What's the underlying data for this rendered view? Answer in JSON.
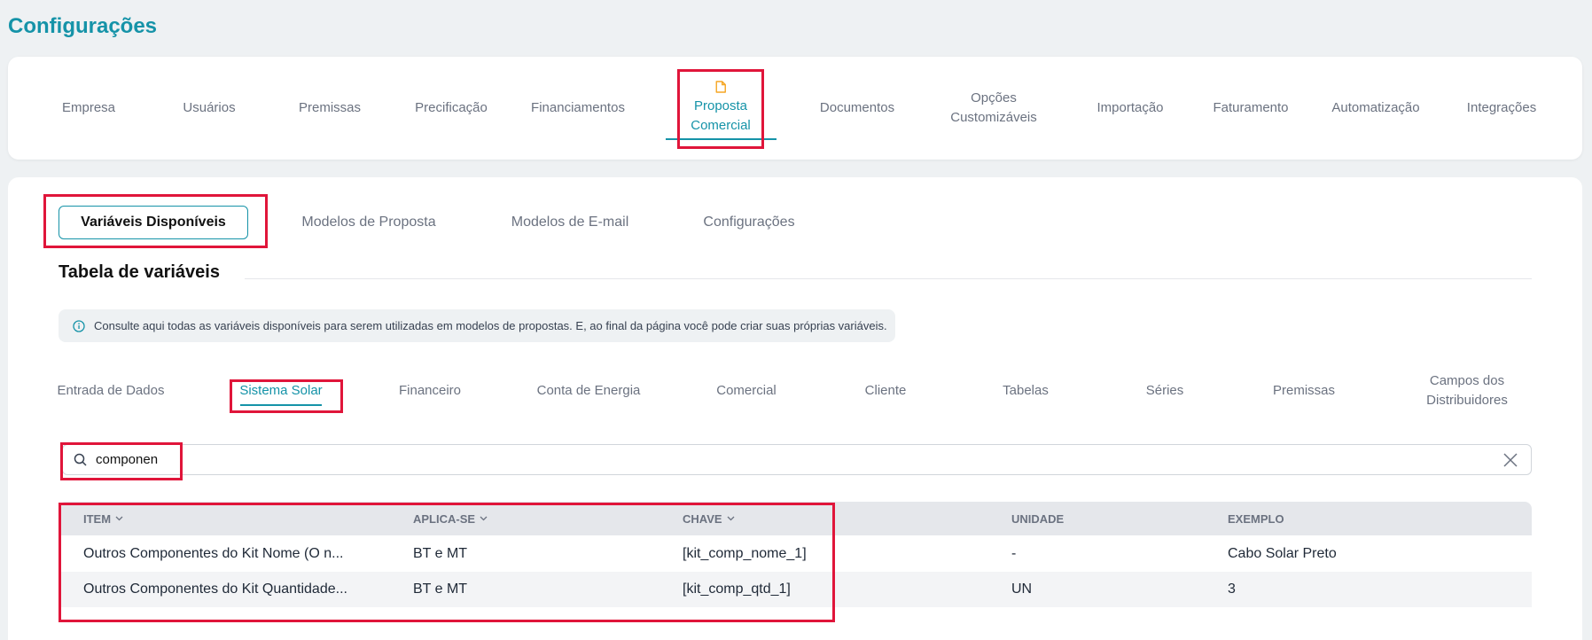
{
  "page_title": "Configurações",
  "nav": {
    "items": [
      {
        "label": "Empresa",
        "lines": [
          "Empresa"
        ]
      },
      {
        "label": "Usuários",
        "lines": [
          "Usuários"
        ]
      },
      {
        "label": "Premissas",
        "lines": [
          "Premissas"
        ]
      },
      {
        "label": "Precificação",
        "lines": [
          "Precificação"
        ]
      },
      {
        "label": "Financiamentos",
        "lines": [
          "Financiamentos"
        ]
      },
      {
        "label": "Proposta Comercial",
        "lines": [
          "Proposta",
          "Comercial"
        ],
        "active": true,
        "icon": "document-icon"
      },
      {
        "label": "Documentos",
        "lines": [
          "Documentos"
        ]
      },
      {
        "label": "Opções Customizáveis",
        "lines": [
          "Opções",
          "Customizáveis"
        ]
      },
      {
        "label": "Importação",
        "lines": [
          "Importação"
        ]
      },
      {
        "label": "Faturamento",
        "lines": [
          "Faturamento"
        ]
      },
      {
        "label": "Automatização",
        "lines": [
          "Automatização"
        ]
      },
      {
        "label": "Integrações",
        "lines": [
          "Integrações"
        ]
      }
    ]
  },
  "subtabs": [
    "Variáveis Disponíveis",
    "Modelos de Proposta",
    "Modelos de E-mail",
    "Configurações"
  ],
  "section_title": "Tabela de variáveis",
  "info_text": "Consulte aqui todas as variáveis disponíveis para serem utilizadas em modelos de propostas. E, ao final da página você pode criar suas próprias variáveis.",
  "categories": [
    {
      "lines": [
        "Entrada de Dados"
      ]
    },
    {
      "lines": [
        "Sistema Solar"
      ],
      "active": true
    },
    {
      "lines": [
        "Financeiro"
      ]
    },
    {
      "lines": [
        "Conta de Energia"
      ]
    },
    {
      "lines": [
        "Comercial"
      ]
    },
    {
      "lines": [
        "Cliente"
      ]
    },
    {
      "lines": [
        "Tabelas"
      ]
    },
    {
      "lines": [
        "Séries"
      ]
    },
    {
      "lines": [
        "Premissas"
      ]
    },
    {
      "lines": [
        "Campos dos",
        "Distribuidores"
      ]
    }
  ],
  "search": {
    "value": "componen"
  },
  "table": {
    "columns": [
      "ITEM",
      "APLICA-SE",
      "CHAVE",
      "UNIDADE",
      "EXEMPLO"
    ],
    "sortable": [
      true,
      true,
      true,
      false,
      false
    ],
    "rows": [
      [
        "Outros Componentes do Kit Nome (O n...",
        "BT e MT",
        "[kit_comp_nome_1]",
        "-",
        "Cabo Solar Preto"
      ],
      [
        "Outros Componentes do Kit Quantidade...",
        "BT e MT",
        "[kit_comp_qtd_1]",
        "UN",
        "3"
      ]
    ]
  },
  "colors": {
    "accent": "#1593a8",
    "highlight": "#e0153a"
  }
}
